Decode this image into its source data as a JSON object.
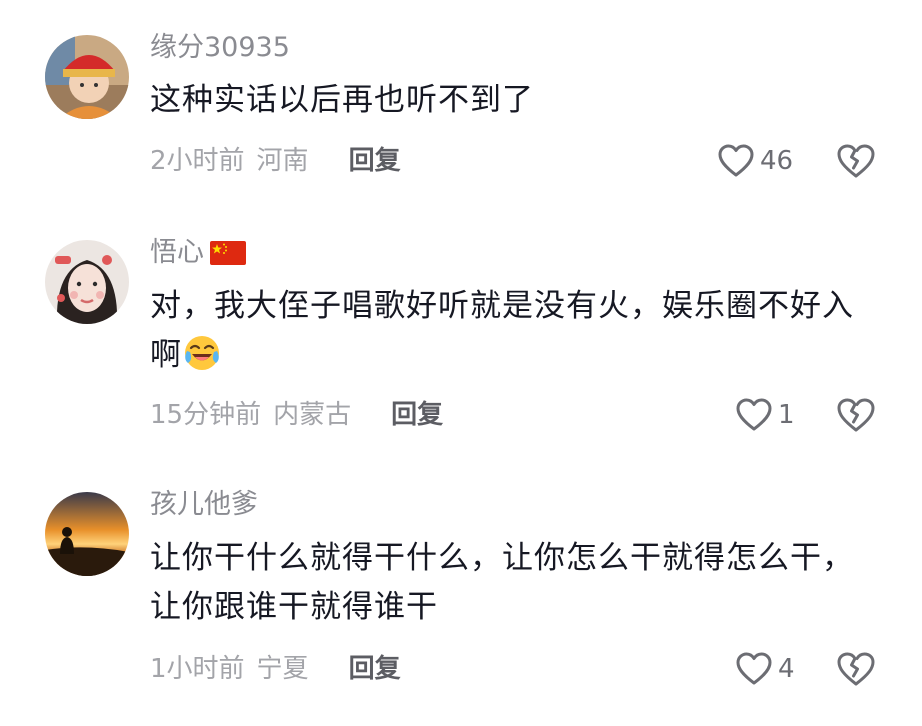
{
  "comments": [
    {
      "username": "缘分30935",
      "text": "这种实话以后再也听不到了",
      "time": "2小时前",
      "location": "河南",
      "reply_label": "回复",
      "likes": "46",
      "avatar": "avatar-child-red-hat"
    },
    {
      "username": "悟心",
      "badge": "china-flag-icon",
      "text": "对，我大侄子唱歌好听就是没有火，娱乐圈不好入啊",
      "emoji": "crying-laughing-emoji",
      "time": "15分钟前",
      "location": "内蒙古",
      "reply_label": "回复",
      "likes": "1",
      "avatar": "avatar-woman-selfie"
    },
    {
      "username": "孩儿他爹",
      "text": "让你干什么就得干什么，让你怎么干就得怎么干，让你跟谁干就得谁干",
      "time": "1小时前",
      "location": "宁夏",
      "reply_label": "回复",
      "likes": "4",
      "avatar": "avatar-sunset-silhouette"
    }
  ],
  "colors": {
    "username": "#8a8b91",
    "text": "#161823",
    "meta": "#a3a4a9",
    "reply": "#5c5d63",
    "icon": "#6c6d73"
  }
}
